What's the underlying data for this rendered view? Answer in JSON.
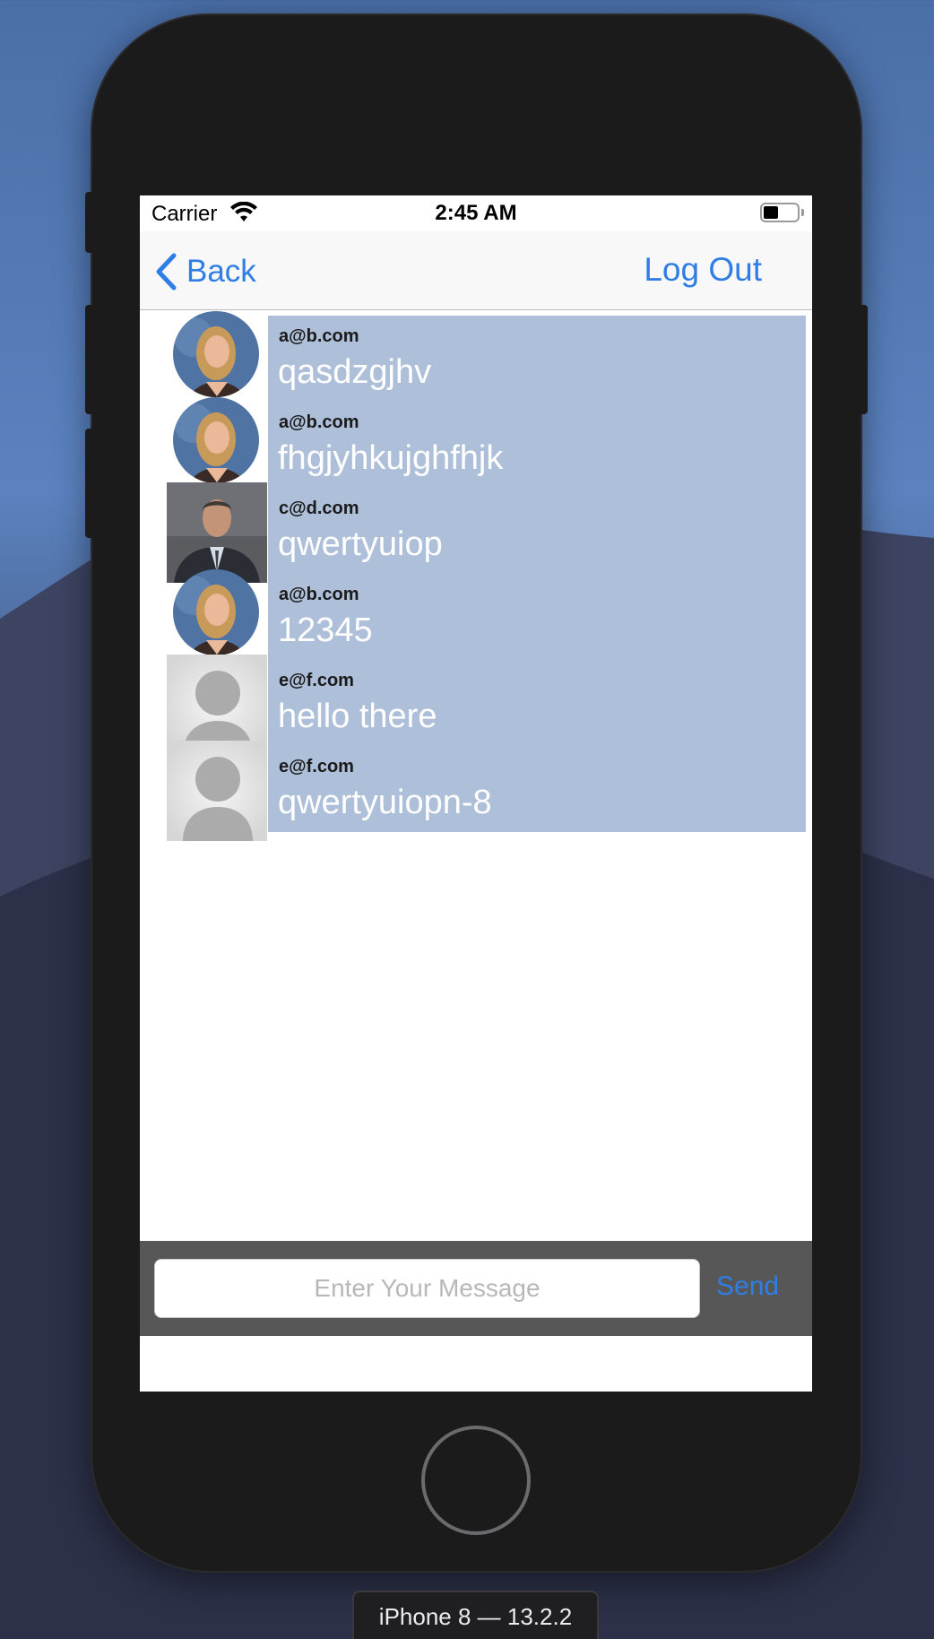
{
  "status_bar": {
    "carrier": "Carrier",
    "time": "2:45 AM"
  },
  "nav": {
    "back_label": "Back",
    "logout_label": "Log Out"
  },
  "messages": [
    {
      "sender": "a@b.com",
      "text": "qasdzgjhv",
      "avatar": "woman-photo-round"
    },
    {
      "sender": "a@b.com",
      "text": "fhgjyhkujghfhjk",
      "avatar": "woman-photo-round"
    },
    {
      "sender": "c@d.com",
      "text": "qwertyuiop",
      "avatar": "man-photo-square"
    },
    {
      "sender": "a@b.com",
      "text": "12345",
      "avatar": "woman-photo-round"
    },
    {
      "sender": "e@f.com",
      "text": "hello there",
      "avatar": "default-person"
    },
    {
      "sender": "e@f.com",
      "text": "qwertyuiopn-8",
      "avatar": "default-person"
    }
  ],
  "composer": {
    "placeholder": "Enter Your Message",
    "value": "",
    "send_label": "Send"
  },
  "simulator": {
    "device_label": "iPhone 8 — 13.2.2"
  },
  "colors": {
    "accent": "#2f7ee6",
    "bubble": "#adbfd9",
    "input_bar": "#575757"
  }
}
